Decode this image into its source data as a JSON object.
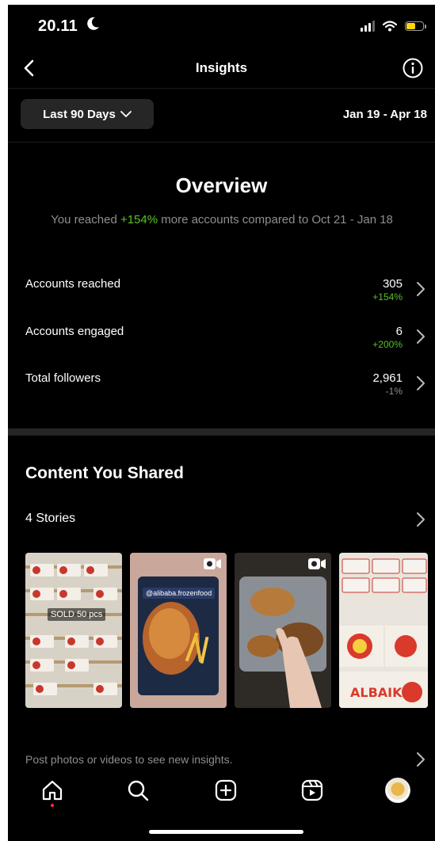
{
  "status_bar": {
    "time": "20.11"
  },
  "header": {
    "title": "Insights"
  },
  "range": {
    "selector_label": "Last 90 Days",
    "dates": "Jan 19 - Apr 18"
  },
  "overview": {
    "title": "Overview",
    "summary_prefix": "You reached ",
    "summary_pct": "+154%",
    "summary_suffix": " more accounts compared to Oct 21 - Jan 18",
    "metrics": [
      {
        "label": "Accounts reached",
        "value": "305",
        "change": "+154%",
        "trend": "positive"
      },
      {
        "label": "Accounts engaged",
        "value": "6",
        "change": "+200%",
        "trend": "positive"
      },
      {
        "label": "Total followers",
        "value": "2,961",
        "change": "-1%",
        "trend": "negative"
      }
    ]
  },
  "content_shared": {
    "title": "Content You Shared",
    "stories_label": "4 Stories",
    "thumbnails": [
      {
        "caption": "SOLD 50 pcs"
      },
      {
        "caption": "@alibaba.frozenfood"
      },
      {
        "caption": ""
      },
      {
        "caption": ""
      }
    ],
    "hint": "Post photos or videos to see new insights."
  },
  "tabbar": {
    "icons": [
      "home-icon",
      "search-icon",
      "create-icon",
      "reels-icon",
      "profile-avatar"
    ]
  },
  "colors": {
    "background": "#000000",
    "positive": "#58c322",
    "muted": "#8e8e8e",
    "button_bg": "#262626"
  }
}
